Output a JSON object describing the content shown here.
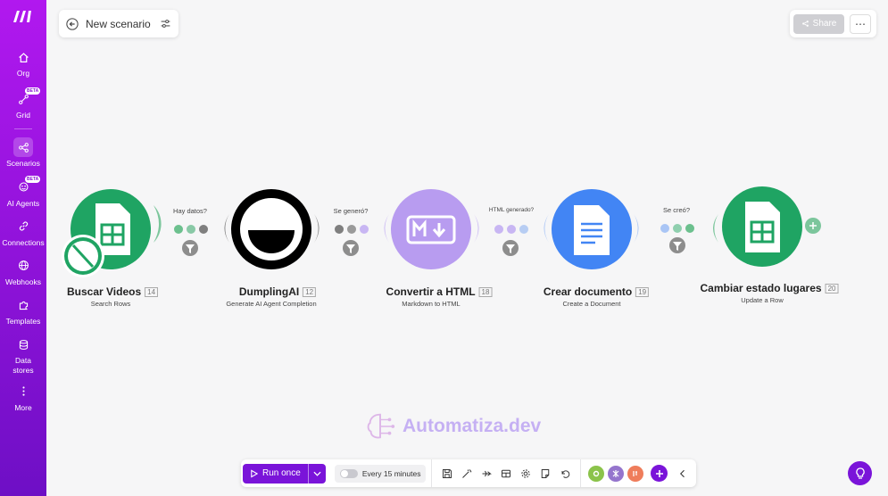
{
  "app": {
    "scenario_name": "New scenario",
    "share_label": "Share",
    "more_label": "⋯"
  },
  "sidebar": {
    "items": [
      {
        "label": "Org",
        "icon": "home-icon"
      },
      {
        "label": "Grid",
        "icon": "grid-icon",
        "badge": "BETA"
      },
      {
        "label": "Scenarios",
        "icon": "share-nodes-icon",
        "active": true
      },
      {
        "label": "AI Agents",
        "icon": "ai-agent-icon",
        "badge": "BETA"
      },
      {
        "label": "Connections",
        "icon": "link-icon"
      },
      {
        "label": "Webhooks",
        "icon": "globe-icon"
      },
      {
        "label": "Templates",
        "icon": "puzzle-icon"
      },
      {
        "label": "Data stores",
        "icon": "database-icon"
      },
      {
        "label": "More",
        "icon": "kebab-icon"
      }
    ]
  },
  "modules": [
    {
      "title": "Buscar Videos",
      "id": "14",
      "subtitle": "Search Rows",
      "app": "google-sheets"
    },
    {
      "title": "DumplingAI",
      "id": "12",
      "subtitle": "Generate AI Agent Completion",
      "app": "dumplingai"
    },
    {
      "title": "Convertir a HTML",
      "id": "18",
      "subtitle": "Markdown to HTML",
      "app": "markdown"
    },
    {
      "title": "Crear documento",
      "id": "19",
      "subtitle": "Create a Document",
      "app": "google-docs"
    },
    {
      "title": "Cambiar estado lugares",
      "id": "20",
      "subtitle": "Update a Row",
      "app": "google-sheets"
    }
  ],
  "connections": [
    {
      "label": "Hay datos?"
    },
    {
      "label": "Se generó?"
    },
    {
      "label": "HTML generado?"
    },
    {
      "label": "Se creó?"
    }
  ],
  "watermark": "Automatiza.dev",
  "toolbar": {
    "run_label": "Run once",
    "schedule_label": "Every 15 minutes"
  },
  "colors": {
    "brand": "#7a14d9",
    "sheets_green": "#1fa463",
    "markdown_purple": "#b89cf0",
    "docs_blue": "#4285f4"
  }
}
